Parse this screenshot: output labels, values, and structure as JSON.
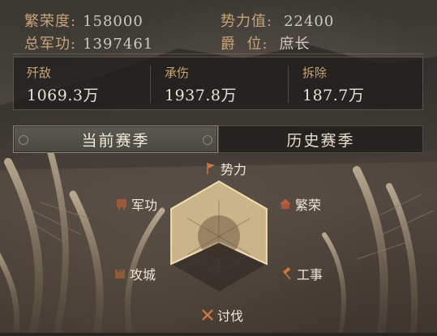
{
  "top_stats": {
    "prosperity": {
      "label": "繁荣度:",
      "value": "158000"
    },
    "power": {
      "label": "势力值:",
      "value": "22400"
    },
    "total_merit": {
      "label": "总军功:",
      "value": "1397461"
    },
    "rank": {
      "label": "爵  位:",
      "value": "庶长"
    }
  },
  "battle_stats": [
    {
      "label": "歼敌",
      "value": "1069.3万"
    },
    {
      "label": "承伤",
      "value": "1937.8万"
    },
    {
      "label": "拆除",
      "value": "187.7万"
    }
  ],
  "tabs": {
    "current": "当前赛季",
    "history": "历史赛季"
  },
  "radar": {
    "axes": [
      {
        "label": "势力",
        "icon": "banner-icon",
        "value": 1.0
      },
      {
        "label": "繁荣",
        "icon": "house-icon",
        "value": 1.0
      },
      {
        "label": "工事",
        "icon": "hammer-icon",
        "value": 1.0
      },
      {
        "label": "讨伐",
        "icon": "crossed-swords-icon",
        "value": 0.1
      },
      {
        "label": "攻城",
        "icon": "siege-icon",
        "value": 1.0
      },
      {
        "label": "军功",
        "icon": "flag-icon",
        "value": 1.0
      }
    ],
    "fill_color": "#e9cf9e",
    "stroke_color": "#f3dcae"
  }
}
